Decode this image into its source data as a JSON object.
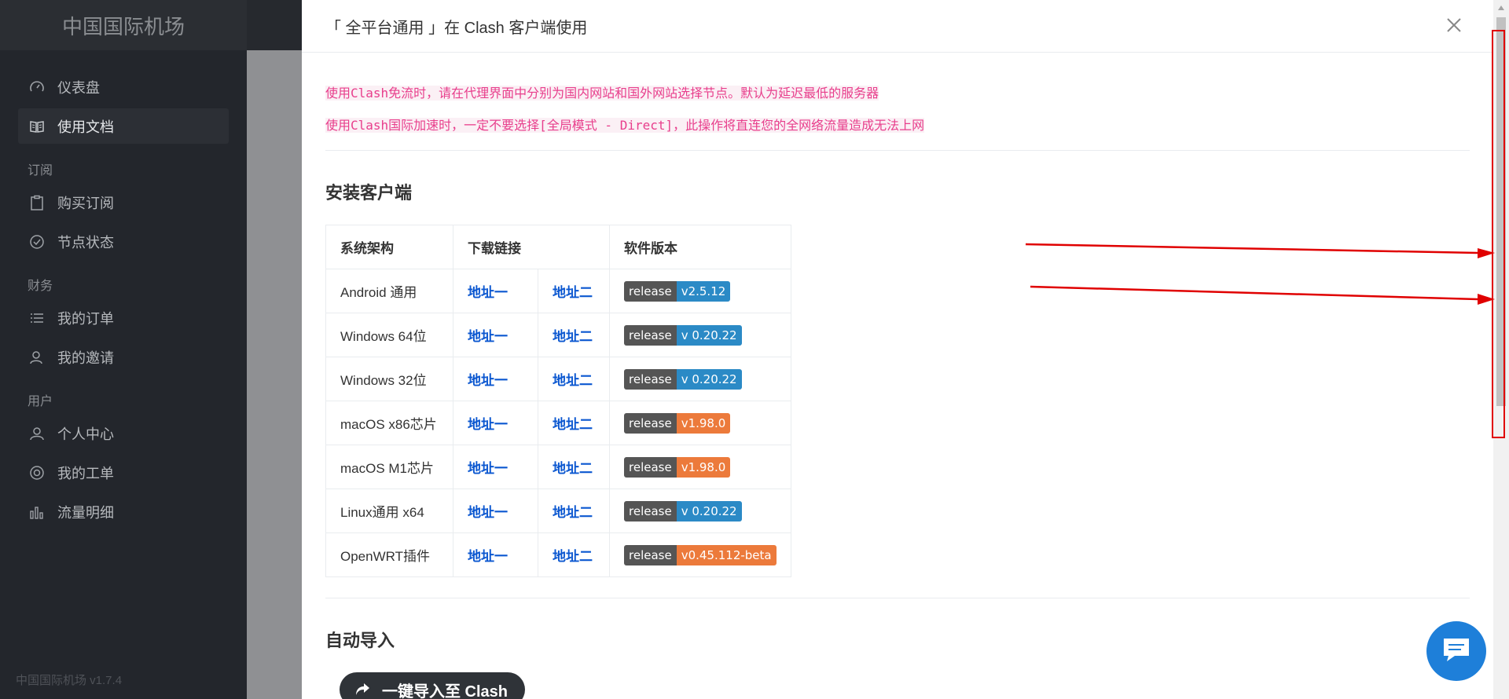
{
  "sidebar": {
    "brand": "中国国际机场",
    "items": {
      "dashboard": "仪表盘",
      "docs": "使用文档",
      "group_subscribe": "订阅",
      "buy": "购买订阅",
      "nodes": "节点状态",
      "group_finance": "财务",
      "orders": "我的订单",
      "invite": "我的邀请",
      "group_user": "用户",
      "profile": "个人中心",
      "tickets": "我的工单",
      "traffic": "流量明细"
    },
    "version": "中国国际机场 v1.7.4"
  },
  "modal": {
    "title": "「 全平台通用 」在 Clash 客户端使用",
    "notes": [
      "使用Clash免流时，请在代理界面中分别为国内网站和国外网站选择节点。默认为延迟最低的服务器",
      "使用Clash国际加速时，一定不要选择[全局模式 - Direct]，此操作将直连您的全网络流量造成无法上网"
    ],
    "install_heading": "安装客户端",
    "table": {
      "headers": {
        "arch": "系统架构",
        "download": "下载链接",
        "version": "软件版本"
      },
      "link1": "地址一",
      "link2": "地址二",
      "badge_left": "release",
      "rows": [
        {
          "arch": "Android 通用",
          "version": "v2.5.12",
          "color": "#2b8ac6"
        },
        {
          "arch": "Windows 64位",
          "version": "v 0.20.22",
          "color": "#2b8ac6"
        },
        {
          "arch": "Windows 32位",
          "version": "v 0.20.22",
          "color": "#2b8ac6"
        },
        {
          "arch": "macOS x86芯片",
          "version": "v1.98.0",
          "color": "#ec7a3b"
        },
        {
          "arch": "macOS M1芯片",
          "version": "v1.98.0",
          "color": "#ec7a3b"
        },
        {
          "arch": "Linux通用 x64",
          "version": "v 0.20.22",
          "color": "#2b8ac6"
        },
        {
          "arch": "OpenWRT插件",
          "version": "v0.45.112-beta",
          "color": "#ec7a3b"
        }
      ]
    },
    "auto_import_heading": "自动导入",
    "import_button": "一键导入至 Clash"
  },
  "icons": {
    "dashboard": "gauge-icon",
    "docs": "book-icon",
    "buy": "clipboard-icon",
    "nodes": "check-circle-icon",
    "orders": "list-icon",
    "invite": "user-add-icon",
    "profile": "user-icon",
    "tickets": "lifebuoy-icon",
    "traffic": "bar-chart-icon",
    "close": "close-icon",
    "chat": "chat-icon",
    "import": "share-arrow-icon"
  }
}
